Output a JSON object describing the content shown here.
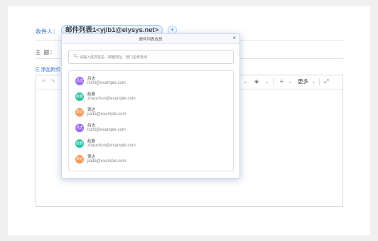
{
  "compose": {
    "recipient_label": "收件人：",
    "recipient_chip": "邮件列表1<yjlb1@elysys.net>",
    "add_recipient": "+",
    "subject_label": "主  题：",
    "attach_label": "添加附件"
  },
  "toolbar": {
    "undo": "↶",
    "redo": "↷",
    "fill": "◈",
    "align": "≡",
    "more": "更多",
    "chevron": "⌄",
    "expand": "⤢"
  },
  "dialog": {
    "title": "邮件列表成员",
    "close": "×",
    "search_placeholder": "请输入成员姓名、邮箱地址、部门名称查询",
    "members": [
      {
        "avatar": "吕志",
        "name": "吕志",
        "email": "lvzhi@example.com",
        "color": "#9b6cf0"
      },
      {
        "avatar": "赵春",
        "name": "赵春",
        "email": "zhaochun@example.com",
        "color": "#2ec4a0"
      },
      {
        "avatar": "贾达",
        "name": "贾达",
        "email": "jiada@example.com",
        "color": "#f39a5b"
      },
      {
        "avatar": "吕志",
        "name": "吕志",
        "email": "lvzhi@example.com",
        "color": "#9b6cf0"
      },
      {
        "avatar": "赵春",
        "name": "赵春",
        "email": "zhaochun@example.com",
        "color": "#2ec4a0"
      },
      {
        "avatar": "贾达",
        "name": "贾达",
        "email": "jiada@example.com",
        "color": "#f39a5b"
      }
    ]
  }
}
